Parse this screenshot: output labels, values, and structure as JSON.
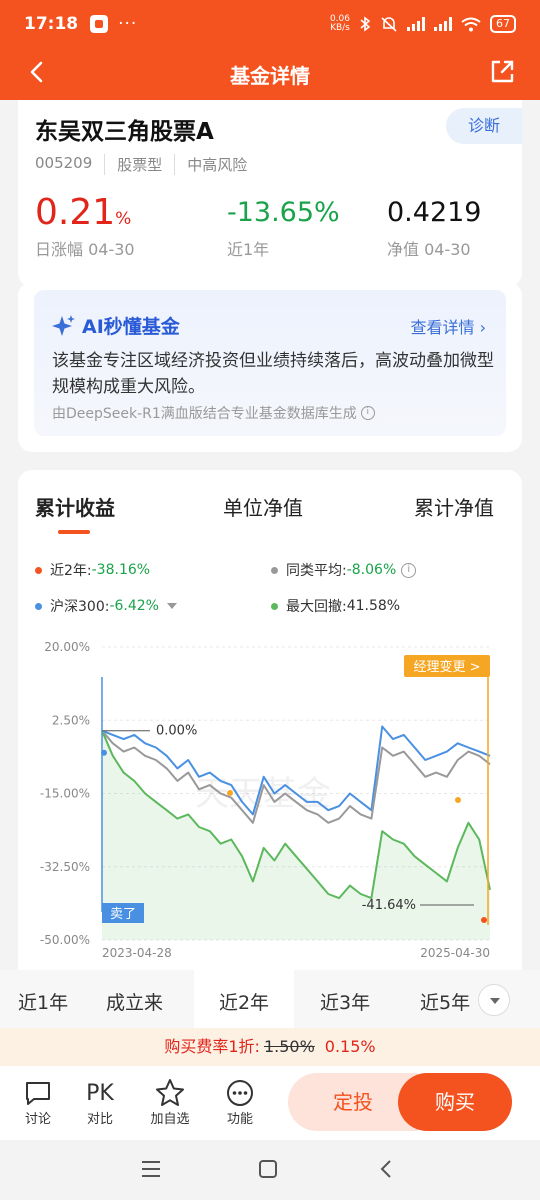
{
  "status_bar": {
    "time": "17:18",
    "dots": "···",
    "net_speed": "0.06\nKB/s",
    "battery": "67"
  },
  "nav": {
    "title": "基金详情"
  },
  "fund": {
    "name": "东吴双三角股票A",
    "diagnose_label": "诊断",
    "tags": [
      "005209",
      "股票型",
      "中高风险"
    ],
    "metrics": [
      {
        "value": "0.21",
        "unit": "%",
        "label": "日涨幅 04-30"
      },
      {
        "value": "-13.65%",
        "label": "近1年"
      },
      {
        "value": "0.4219",
        "label": "净值 04-30"
      }
    ]
  },
  "ai": {
    "title": "AI秒懂基金",
    "more": "查看详情",
    "text": "该基金专注区域经济投资但业绩持续落后，高波动叠加微型规模构成重大风险。",
    "source": "由DeepSeek-R1满血版结合专业基金数据库生成"
  },
  "chart_tabs": [
    "累计收益",
    "单位净值",
    "累计净值"
  ],
  "legend": {
    "l1_label": "近2年:",
    "l1_value": "-38.16%",
    "l2_label": "同类平均:",
    "l2_value": "-8.06%",
    "l3_label": "沪深300:",
    "l3_value": "-6.42%",
    "l4_label": "最大回撤:",
    "l4_value": "41.58%"
  },
  "chart_labels": {
    "manager_change": "经理变更 >",
    "sold": "卖了",
    "zero": "0.00%",
    "min": "-41.64%",
    "watermark": "天天基金"
  },
  "chart_data": {
    "type": "line",
    "ylim": [
      -50,
      20
    ],
    "yticks": [
      "20.00%",
      "2.50%",
      "-15.00%",
      "-32.50%",
      "-50.00%"
    ],
    "x_range": [
      "2023-04-28",
      "2025-04-30"
    ],
    "series": [
      {
        "name": "近2年",
        "color": "#5cb85c",
        "values": [
          0,
          -6,
          -10,
          -12,
          -15,
          -17,
          -19,
          -21,
          -20,
          -23,
          -24,
          -27,
          -26,
          -30,
          -36,
          -28,
          -31,
          -27,
          -30,
          -33,
          -36,
          -39,
          -40,
          -37,
          -39,
          -40,
          -24,
          -26,
          -27,
          -30,
          -32,
          -34,
          -36,
          -28,
          -22,
          -26,
          -38
        ]
      },
      {
        "name": "同类平均",
        "color": "#999999",
        "values": [
          0,
          -3,
          -5,
          -4,
          -6,
          -7,
          -9,
          -12,
          -10,
          -14,
          -13,
          -15,
          -16,
          -19,
          -22,
          -13,
          -17,
          -15,
          -17,
          -19,
          -20,
          -22,
          -21,
          -18,
          -20,
          -21,
          -4,
          -6,
          -5,
          -8,
          -11,
          -10,
          -11,
          -7,
          -5,
          -6,
          -8
        ]
      },
      {
        "name": "沪深300",
        "color": "#4a90e2",
        "values": [
          0,
          -1,
          -2,
          -1,
          -3,
          -4,
          -6,
          -9,
          -7,
          -11,
          -10,
          -12,
          -13,
          -17,
          -20,
          -11,
          -15,
          -13,
          -15,
          -17,
          -17,
          -19,
          -18,
          -15,
          -17,
          -19,
          1,
          -2,
          -1,
          -4,
          -7,
          -6,
          -5,
          -3,
          -4,
          -5,
          -6
        ]
      }
    ]
  },
  "periods": [
    "近1年",
    "成立来",
    "近2年",
    "近3年",
    "近5年"
  ],
  "fee": {
    "label": "购买费率1折:",
    "old": "1.50%",
    "new": "0.15%"
  },
  "bottom": {
    "items": [
      {
        "icon": "comment-icon",
        "label": "讨论"
      },
      {
        "icon": "compare-icon",
        "glyph": "PK",
        "label": "对比"
      },
      {
        "icon": "star-icon",
        "label": "加自选"
      },
      {
        "icon": "more-icon",
        "label": "功能"
      }
    ],
    "dingtou": "定投",
    "buy": "购买"
  },
  "colors": {
    "brand": "#f4521e",
    "up": "#e1251b",
    "down": "#1aa34a"
  }
}
